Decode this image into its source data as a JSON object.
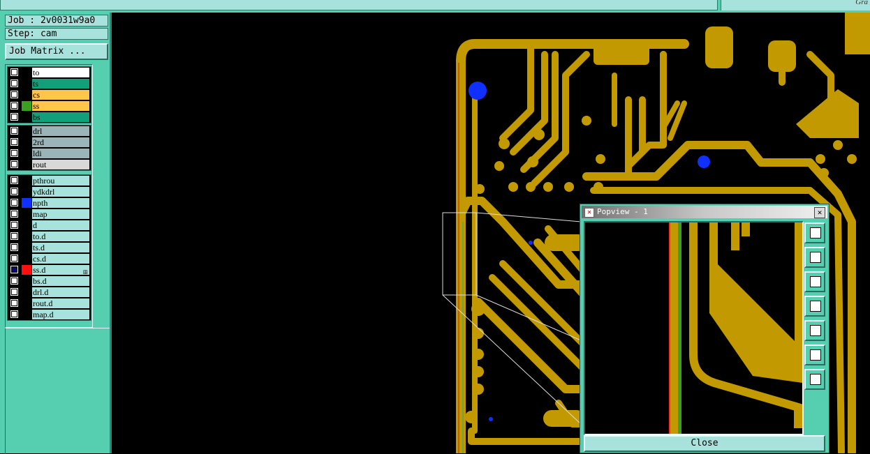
{
  "topbar": {
    "right_text": "Gra"
  },
  "job": {
    "label": "Job : 2v0031w9a0",
    "step": "Step: cam",
    "matrix_button": "Job Matrix ..."
  },
  "layer_groups": [
    [
      {
        "name": "to",
        "color": "#ffffff",
        "swatch": "#000000"
      },
      {
        "name": "ts",
        "color": "#12a07a",
        "swatch": "#000000"
      },
      {
        "name": "cs",
        "color": "#ffc64a",
        "swatch": "#000000"
      },
      {
        "name": "ss",
        "color": "#ffc64a",
        "swatch": "#3aa020"
      },
      {
        "name": "bs",
        "color": "#12a07a",
        "swatch": "#000000"
      }
    ],
    [
      {
        "name": "drl",
        "color": "#9ab4b8",
        "swatch": "#000000"
      },
      {
        "name": "2rd",
        "color": "#9ab4b8",
        "swatch": "#000000"
      },
      {
        "name": "ldi",
        "color": "#9ab4b8",
        "swatch": "#000000"
      },
      {
        "name": "rout",
        "color": "#d8d8d8",
        "swatch": "#000000"
      }
    ],
    [
      {
        "name": "pthrou",
        "color": "#a8e2dc",
        "swatch": "#000000"
      },
      {
        "name": "ydkdrl",
        "color": "#a8e2dc",
        "swatch": "#000000"
      },
      {
        "name": "npth",
        "color": "#a8e2dc",
        "swatch": "#1030ff"
      },
      {
        "name": "map",
        "color": "#a8e2dc",
        "swatch": "#000000"
      },
      {
        "name": "d",
        "color": "#a8e2dc",
        "swatch": "#000000"
      },
      {
        "name": "to.d",
        "color": "#a8e2dc",
        "swatch": "#000000"
      },
      {
        "name": "ts.d",
        "color": "#a8e2dc",
        "swatch": "#000000"
      },
      {
        "name": "cs.d",
        "color": "#a8e2dc",
        "swatch": "#000000"
      },
      {
        "name": "ss.d",
        "color": "#a8e2dc",
        "swatch": "#ff1010",
        "selected": true
      },
      {
        "name": "bs.d",
        "color": "#a8e2dc",
        "swatch": "#000000"
      },
      {
        "name": "drl.d",
        "color": "#a8e2dc",
        "swatch": "#000000"
      },
      {
        "name": "rout.d",
        "color": "#a8e2dc",
        "swatch": "#000000"
      },
      {
        "name": "map.d",
        "color": "#a8e2dc",
        "swatch": "#000000"
      }
    ]
  ],
  "popview": {
    "title": "Popview - 1",
    "close_label": "Close",
    "tools": [
      "zoom-box-icon",
      "pan-up-icon",
      "pan-down-icon",
      "pan-left-icon",
      "pan-right-icon",
      "zoom-fit-icon",
      "move-center-icon"
    ]
  },
  "colors": {
    "copper": "#c29a00",
    "mask": "#12a07a",
    "drill": "#1030ff",
    "panel": "#56cfb0",
    "field": "#a8e2dc"
  }
}
